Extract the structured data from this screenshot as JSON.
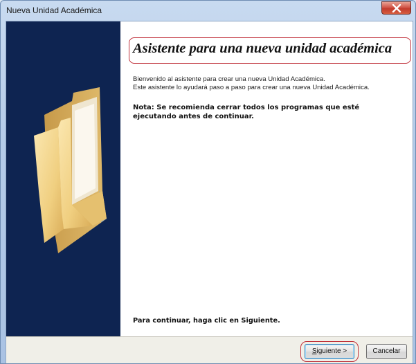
{
  "window": {
    "title": "Nueva Unidad Académica"
  },
  "wizard": {
    "heading": "Asistente para una nueva unidad académica",
    "welcome_line1": "Bienvenido al asistente para crear una nueva Unidad Académica.",
    "welcome_line2": "Este asistente lo ayudará paso a paso para crear una nueva Unidad Académica.",
    "note": "Nota: Se recomienda cerrar todos los programas que esté ejecutando antes de continuar.",
    "continue_text": "Para continuar, haga clic en Siguiente."
  },
  "buttons": {
    "next_mnemonic": "S",
    "next_rest": "iguiente >",
    "cancel": "Cancelar"
  },
  "icons": {
    "close": "close-icon",
    "folder": "folder-icon"
  },
  "colors": {
    "side_panel": "#0e2451",
    "highlight_ring": "#c0303a",
    "close_button": "#c23b2e"
  }
}
